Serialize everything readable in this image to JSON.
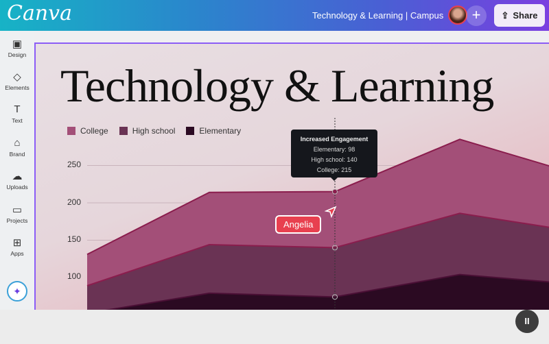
{
  "header": {
    "logo": "Canva",
    "doc_title": "Technology & Learning | Campus",
    "add_label": "+",
    "share_label": "Share"
  },
  "sidebar": {
    "items": [
      {
        "label": "Design",
        "icon": "▣"
      },
      {
        "label": "Elements",
        "icon": "◇"
      },
      {
        "label": "Text",
        "icon": "T"
      },
      {
        "label": "Brand",
        "icon": "⌂"
      },
      {
        "label": "Uploads",
        "icon": "☁"
      },
      {
        "label": "Projects",
        "icon": "▭"
      },
      {
        "label": "Apps",
        "icon": "⊞"
      }
    ],
    "magic_icon": "✦"
  },
  "canvas": {
    "headline": "Technology & Learning"
  },
  "tooltip": {
    "title": "Increased Engagement",
    "lines": [
      "Elementary: 98",
      "High school: 140",
      "College: 215"
    ]
  },
  "collaborator": {
    "name": "Angelia",
    "color": "#e8404f"
  },
  "playback": {
    "pause_icon": "II"
  },
  "chart_data": {
    "type": "area",
    "x": [
      1,
      2,
      3,
      4,
      5
    ],
    "yticks": [
      "250",
      "200",
      "150",
      "100"
    ],
    "grid": true,
    "legend": "top-left",
    "series": [
      {
        "name": "College",
        "color": "#a34f78",
        "values": [
          131,
          214,
          215,
          285,
          249
        ]
      },
      {
        "name": "High school",
        "color": "#6a3354",
        "values": [
          89,
          144,
          140,
          186,
          167
        ]
      },
      {
        "name": "Elementary",
        "color": "#2b0a22",
        "values": [
          52,
          79,
          74,
          104,
          94
        ]
      }
    ]
  }
}
